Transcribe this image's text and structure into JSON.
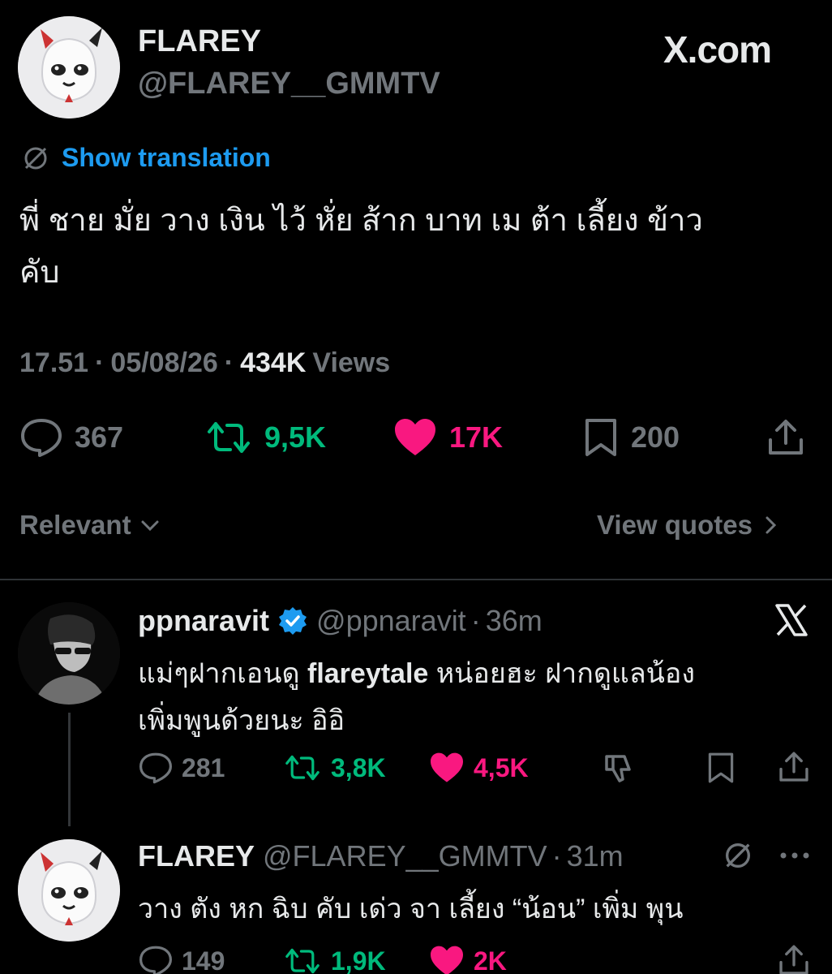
{
  "source_logo": "X.com",
  "main_tweet": {
    "display_name": "FLAREY",
    "handle": "@FLAREY__GMMTV",
    "show_translation": "Show translation",
    "text_line1": "พี่ ชาย มั่ย วาง เงิน ไว้ หั่ย ส้าก บาท เม ต้า เลี้ยง ข้าว",
    "text_line2": "คับ",
    "time": "17.51",
    "date": "05/08/26",
    "views_count": "434K",
    "views_label": "Views",
    "separator": "·",
    "stats": {
      "replies": "367",
      "reposts": "9,5K",
      "likes": "17K",
      "bookmarks": "200"
    }
  },
  "sort": {
    "label": "Relevant",
    "view_quotes": "View quotes"
  },
  "replies": [
    {
      "display_name": "ppnaravit",
      "handle": "@ppnaravit",
      "age": "36m",
      "verified": true,
      "text_line1_a": "แม่ๆฝากเอนดู ",
      "text_line1_b": "flareytale",
      "text_line1_c": " หน่อยฮะ ฝากดูแลน้อง",
      "text_line2": "เพิ่มพูนด้วยนะ อิอิ",
      "stats": {
        "replies": "281",
        "reposts": "3,8K",
        "likes": "4,5K"
      }
    },
    {
      "display_name": "FLAREY",
      "handle": "@FLAREY__GMMTV",
      "age": "31m",
      "text_line1": "วาง ตัง หก ฉิบ คับ เด่ว จา เลี้ยง “น้อน” เพิ่ม พุน",
      "stats": {
        "replies": "149",
        "reposts": "1,9K",
        "likes": "2K"
      }
    }
  ],
  "colors": {
    "background": "#000000",
    "text": "#e7e9ea",
    "secondary": "#71767b",
    "link": "#1d9bf0",
    "repost": "#00ba7c",
    "like": "#f91880"
  }
}
